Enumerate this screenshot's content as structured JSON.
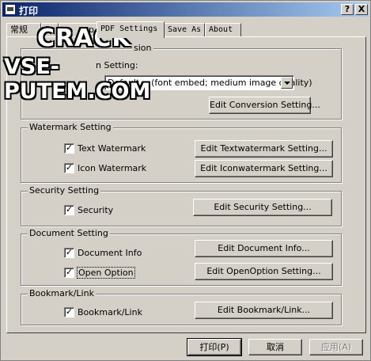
{
  "window": {
    "title": "打印",
    "help_btn": "?",
    "close_btn": "X"
  },
  "tabs": [
    "常规",
    "P",
    "p",
    "PDF Settings",
    "Save As",
    "About"
  ],
  "conversion": {
    "group_title": "sion",
    "setting_label": "n Setting:",
    "select_value": "Default -- (font embed; medium image quality)",
    "edit_button": "Edit Conversion Setting..."
  },
  "watermark": {
    "group_title": "Watermark Setting",
    "text_label": "Text Watermark",
    "icon_label": "Icon Watermark",
    "text_button": "Edit Textwatermark Setting...",
    "icon_button": "Edit Iconwatermark Setting...",
    "text_checked": "✓",
    "icon_checked": "✓"
  },
  "security": {
    "group_title": "Security Setting",
    "label": "Security",
    "checked": "✓",
    "button": "Edit Security Setting..."
  },
  "document": {
    "group_title": "Document Setting",
    "info_label": "Document Info",
    "open_label": "Open Option",
    "info_checked": "✓",
    "open_checked": "✓",
    "info_button": "Edit Document Info...",
    "open_button": "Edit OpenOption Setting..."
  },
  "bookmark": {
    "group_title": "Bookmark/Link",
    "label": "Bookmark/Link",
    "checked": "✓",
    "button": "Edit Bookmark/Link..."
  },
  "footer": {
    "print": "打印(P)",
    "cancel": "取消",
    "apply": "应用(A)"
  },
  "overlay": {
    "line1": "CRACK",
    "line2": "VSE-PUTEM.COM"
  }
}
